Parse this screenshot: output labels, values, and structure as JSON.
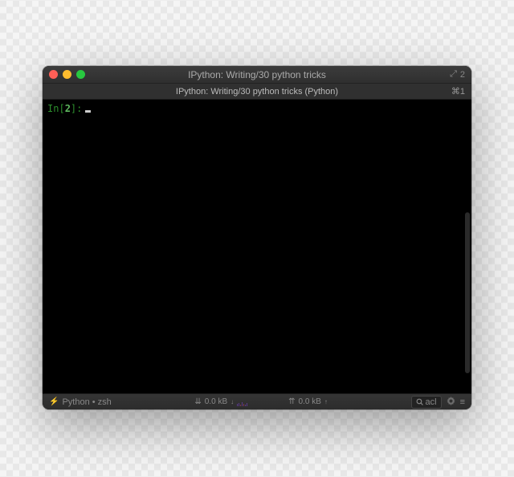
{
  "titlebar": {
    "title": "IPython: Writing/30 python tricks",
    "right_icon": "⤢",
    "right_badge": "2"
  },
  "tab": {
    "label": "IPython: Writing/30 python tricks (Python)",
    "shortcut": "⌘1"
  },
  "terminal": {
    "prompt_in": "In ",
    "prompt_open": "[",
    "prompt_num": "2",
    "prompt_close": "]: "
  },
  "statusbar": {
    "session": "Python • zsh",
    "net_down_icon": "⇊",
    "net_down": "0.0 kB",
    "net_down_arrow": "↓",
    "net_up_icon": "⇈",
    "net_up": "0.0 kB",
    "net_up_arrow": "↑",
    "search_value": "acl"
  }
}
